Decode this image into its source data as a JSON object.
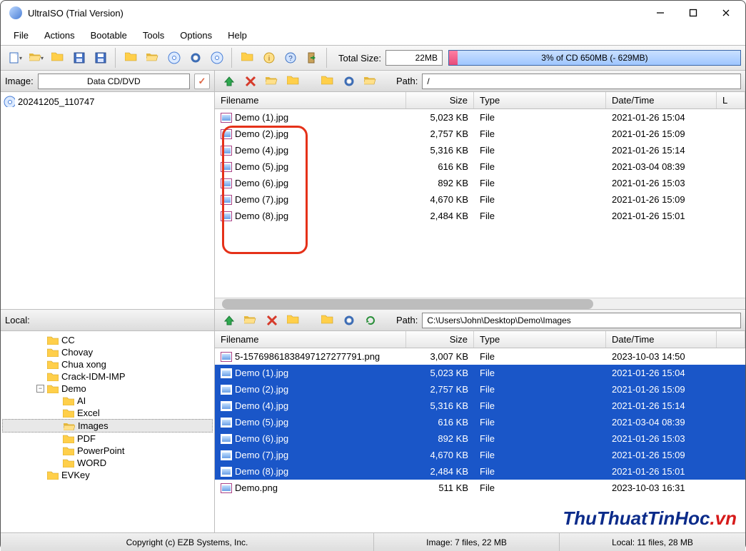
{
  "window": {
    "title": "UltraISO (Trial Version)"
  },
  "menu": {
    "items": [
      "File",
      "Actions",
      "Bootable",
      "Tools",
      "Options",
      "Help"
    ]
  },
  "toolbar": {
    "total_size_label": "Total Size:",
    "total_size_value": "22MB",
    "progress_text": "3% of CD 650MB (- 629MB)",
    "progress_fill_pct": 3
  },
  "image_panel": {
    "label": "Image:",
    "media_type": "Data CD/DVD",
    "tree_root": "20241205_110747",
    "path_label": "Path:",
    "path_value": "/",
    "columns": {
      "name": "Filename",
      "size": "Size",
      "type": "Type",
      "date": "Date/Time",
      "extra": "L"
    },
    "files": [
      {
        "name": "Demo (1).jpg",
        "size": "5,023 KB",
        "type": "File",
        "date": "2021-01-26 15:04"
      },
      {
        "name": "Demo (2).jpg",
        "size": "2,757 KB",
        "type": "File",
        "date": "2021-01-26 15:09"
      },
      {
        "name": "Demo (4).jpg",
        "size": "5,316 KB",
        "type": "File",
        "date": "2021-01-26 15:14"
      },
      {
        "name": "Demo (5).jpg",
        "size": "616 KB",
        "type": "File",
        "date": "2021-03-04 08:39"
      },
      {
        "name": "Demo (6).jpg",
        "size": "892 KB",
        "type": "File",
        "date": "2021-01-26 15:03"
      },
      {
        "name": "Demo (7).jpg",
        "size": "4,670 KB",
        "type": "File",
        "date": "2021-01-26 15:09"
      },
      {
        "name": "Demo (8).jpg",
        "size": "2,484 KB",
        "type": "File",
        "date": "2021-01-26 15:01"
      }
    ]
  },
  "local_panel": {
    "label": "Local:",
    "path_label": "Path:",
    "path_value": "C:\\Users\\John\\Desktop\\Demo\\Images",
    "tree": [
      {
        "indent": 1,
        "label": "CC"
      },
      {
        "indent": 1,
        "label": "Chovay"
      },
      {
        "indent": 1,
        "label": "Chua xong"
      },
      {
        "indent": 1,
        "label": "Crack-IDM-IMP"
      },
      {
        "indent": 1,
        "label": "Demo",
        "expandable": true,
        "expanded": true
      },
      {
        "indent": 2,
        "label": "AI"
      },
      {
        "indent": 2,
        "label": "Excel"
      },
      {
        "indent": 2,
        "label": "Images",
        "selected": true,
        "open": true
      },
      {
        "indent": 2,
        "label": "PDF"
      },
      {
        "indent": 2,
        "label": "PowerPoint"
      },
      {
        "indent": 2,
        "label": "WORD"
      },
      {
        "indent": 1,
        "label": "EVKey"
      }
    ],
    "columns": {
      "name": "Filename",
      "size": "Size",
      "type": "Type",
      "date": "Date/Time"
    },
    "files": [
      {
        "name": "5-15769861838497127277791.png",
        "size": "3,007 KB",
        "type": "File",
        "date": "2023-10-03 14:50",
        "selected": false
      },
      {
        "name": "Demo (1).jpg",
        "size": "5,023 KB",
        "type": "File",
        "date": "2021-01-26 15:04",
        "selected": true
      },
      {
        "name": "Demo (2).jpg",
        "size": "2,757 KB",
        "type": "File",
        "date": "2021-01-26 15:09",
        "selected": true
      },
      {
        "name": "Demo (4).jpg",
        "size": "5,316 KB",
        "type": "File",
        "date": "2021-01-26 15:14",
        "selected": true
      },
      {
        "name": "Demo (5).jpg",
        "size": "616 KB",
        "type": "File",
        "date": "2021-03-04 08:39",
        "selected": true
      },
      {
        "name": "Demo (6).jpg",
        "size": "892 KB",
        "type": "File",
        "date": "2021-01-26 15:03",
        "selected": true
      },
      {
        "name": "Demo (7).jpg",
        "size": "4,670 KB",
        "type": "File",
        "date": "2021-01-26 15:09",
        "selected": true
      },
      {
        "name": "Demo (8).jpg",
        "size": "2,484 KB",
        "type": "File",
        "date": "2021-01-26 15:01",
        "selected": true
      },
      {
        "name": "Demo.png",
        "size": "511 KB",
        "type": "File",
        "date": "2023-10-03 16:31",
        "selected": false
      }
    ]
  },
  "statusbar": {
    "copyright": "Copyright (c) EZB Systems, Inc.",
    "image_status": "Image: 7 files, 22 MB",
    "local_status": "Local: 11 files, 28 MB"
  },
  "watermark": {
    "main": "ThuThuatTinHoc",
    "suffix": ".vn"
  }
}
